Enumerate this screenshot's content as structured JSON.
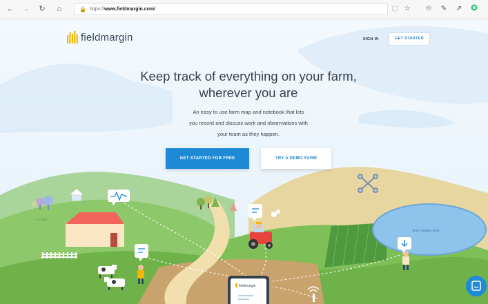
{
  "browser": {
    "url_prefix": "https://",
    "url_host": "www.fieldmargin.com/"
  },
  "header": {
    "logo_text": "fieldmargin",
    "signin_label": "SIGN IN",
    "get_started_label": "GET STARTED"
  },
  "hero": {
    "headline_line1": "Keep track of everything on your farm,",
    "headline_line2": "wherever you are",
    "subtitle_line1": "An easy to use farm map and notebook that lets",
    "subtitle_line2": "you record and discuss work and observations with",
    "subtitle_line3": "your team as they happen.",
    "cta_primary": "GET STARTED FOR FREE",
    "cta_secondary": "TRY A DEMO FARM"
  },
  "illustration": {
    "phone_label": "fieldmargin",
    "pond_label": "East village pond",
    "orchard_label": "Orchard"
  },
  "colors": {
    "brand_yellow": "#f2b705",
    "primary_blue": "#1e8ad6",
    "field_green": "#7cc24a",
    "sky": "#e9f3fb"
  }
}
